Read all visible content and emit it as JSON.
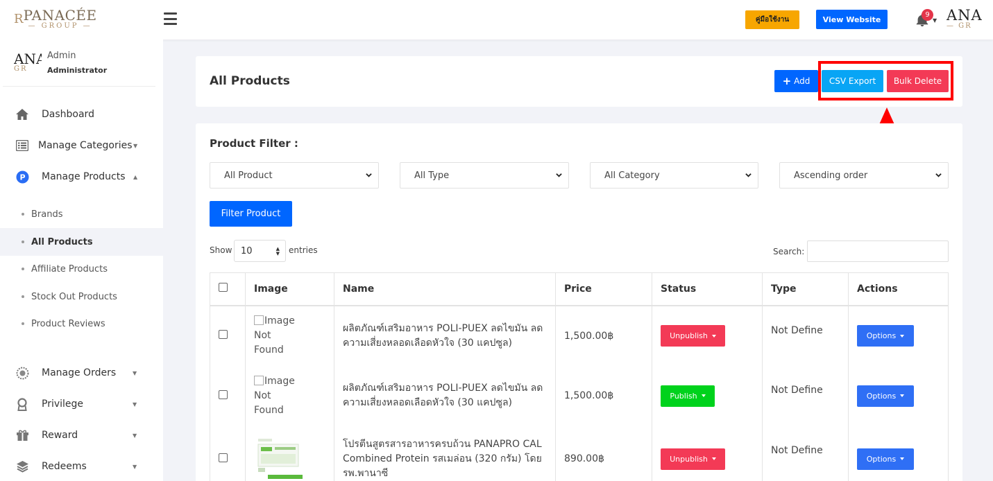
{
  "header": {
    "logo_name": "PANACÉE",
    "logo_sub": "— GROUP —",
    "logo_mark": "R",
    "manual_label": "คู่มือใช้งาน",
    "view_website_label": "View Website",
    "notification_count": "9",
    "avatar_text_1": "ANA",
    "avatar_text_2": "— GR"
  },
  "sidebar": {
    "profile": {
      "name": "Admin",
      "role": "Administrator",
      "avatar_text_1": "ANA",
      "avatar_text_2": "GR"
    },
    "items": [
      {
        "label": "Dashboard",
        "icon": "home-icon"
      },
      {
        "label": "Manage Categories",
        "icon": "list-icon"
      },
      {
        "label": "Manage Products",
        "icon": "product-p-icon"
      },
      {
        "label": "Manage Orders",
        "icon": "orders-icon"
      },
      {
        "label": "Privilege",
        "icon": "award-icon"
      },
      {
        "label": "Reward",
        "icon": "gift-icon"
      },
      {
        "label": "Redeems",
        "icon": "layers-icon"
      }
    ],
    "sub_items": [
      {
        "label": "Brands"
      },
      {
        "label": "All Products"
      },
      {
        "label": "Affiliate Products"
      },
      {
        "label": "Stock Out Products"
      },
      {
        "label": "Product Reviews"
      }
    ]
  },
  "page": {
    "title": "All Products",
    "add_label": "Add",
    "csv_export_label": "CSV Export",
    "bulk_delete_label": "Bulk Delete"
  },
  "filter": {
    "title": "Product Filter :",
    "selects": [
      "All Product",
      "All Type",
      "All Category",
      "Ascending order"
    ],
    "filter_button": "Filter Product"
  },
  "table_controls": {
    "show_label": "Show",
    "page_length": "10",
    "entries_label": "entries",
    "search_label": "Search:"
  },
  "table": {
    "columns": [
      "Image",
      "Name",
      "Price",
      "Status",
      "Type",
      "Actions"
    ],
    "rows": [
      {
        "image_alt": "Image Not Found",
        "name": "ผลิตภัณฑ์เสริมอาหาร POLI-PUEX ลดไขมัน ลดความเสี่ยงหลอดเลือดหัวใจ (30 แคปซูล)",
        "price": "1,500.00฿",
        "status": "Unpublish",
        "type": "Not Define",
        "action": "Options"
      },
      {
        "image_alt": "Image Not Found",
        "name": "ผลิตภัณฑ์เสริมอาหาร POLI-PUEX ลดไขมัน ลดความเสี่ยงหลอดเลือดหัวใจ (30 แคปซูล)",
        "price": "1,500.00฿",
        "status": "Publish",
        "type": "Not Define",
        "action": "Options"
      },
      {
        "image_alt": "",
        "name": "โปรตีนสูตรสารอาหารครบถ้วน PANAPRO CAL Combined Protein รสเมล่อน (320 กรัม) โดย รพ.พานาซี",
        "price": "890.00฿",
        "status": "Unpublish",
        "type": "Not Define",
        "action": "Options"
      }
    ]
  },
  "colors": {
    "primary": "#0066ff",
    "info": "#08a5f5",
    "danger": "#f33a56",
    "success": "#00d21c",
    "warning": "#f7a600",
    "highlight": "#ff0000"
  }
}
